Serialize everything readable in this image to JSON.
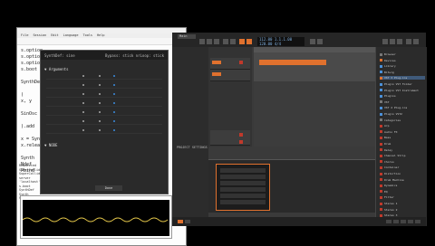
{
  "editor": {
    "menu": [
      "File",
      "Session",
      "Edit",
      "Language",
      "Tools",
      "Help"
    ],
    "code_lines": [
      "s.options",
      "s.options",
      "s.options",
      "s.boot",
      "",
      "SynthDef",
      "",
      "(",
      "  x, y",
      "",
      "  SinOsc",
      "",
      ").add",
      "",
      "x = Synth",
      "x.release",
      "",
      "Synth",
      "Ndef",
      "Pbind"
    ],
    "post_lines": [
      "Requested",
      "SuperCollider",
      "SuperCollider",
      "server 'localhost'",
      "s.boot",
      "SynthDef",
      "Synth",
      "Synth"
    ]
  },
  "panel": {
    "header_left": "SynthDef: sine",
    "header_right": "Bypass: stick  nrLoop: stick",
    "section1": "Arguments",
    "section2": "NODE",
    "button": "Done"
  },
  "daw": {
    "tab": "Main",
    "counter_line1": "112.00  1.1.1.00",
    "counter_line2": "120.00  4/4",
    "inspector_label": "PROJECT SETTINGS",
    "browser_items": [
      {
        "label": "Browser",
        "color": "#777777"
      },
      {
        "label": "Devices",
        "color": "#e0712e"
      },
      {
        "label": "Library",
        "color": "#4a90d9"
      },
      {
        "label": "Bitwig",
        "color": "#4a90d9"
      },
      {
        "label": "VST 3 Plug-ins",
        "color": "#e0712e"
      },
      {
        "label": "Plugin VST Folder",
        "color": "#4a90d9"
      },
      {
        "label": "Plugin VST Instrument",
        "color": "#4a90d9"
      },
      {
        "label": "Plugins",
        "color": "#4a90d9"
      },
      {
        "label": "VST",
        "color": "#777777"
      },
      {
        "label": "VST 2 Plug-ins",
        "color": "#4a90d9"
      },
      {
        "label": "Plugin VST2",
        "color": "#4a90d9"
      },
      {
        "label": "Categories",
        "color": "#777777"
      },
      {
        "label": "Arp",
        "color": "#c0392b"
      },
      {
        "label": "Audio FX",
        "color": "#c0392b"
      },
      {
        "label": "Bass",
        "color": "#c0392b"
      },
      {
        "label": "Drum",
        "color": "#c0392b"
      },
      {
        "label": "Delay",
        "color": "#c0392b"
      },
      {
        "label": "Channel Strip",
        "color": "#c0392b"
      },
      {
        "label": "Chorus",
        "color": "#c0392b"
      },
      {
        "label": "Container",
        "color": "#c0392b"
      },
      {
        "label": "Distortion",
        "color": "#c0392b"
      },
      {
        "label": "Drum Machine",
        "color": "#c0392b"
      },
      {
        "label": "Dynamics",
        "color": "#c0392b"
      },
      {
        "label": "EQ",
        "color": "#c0392b"
      },
      {
        "label": "Filter",
        "color": "#c0392b"
      },
      {
        "label": "Stereo 1",
        "color": "#c0392b"
      },
      {
        "label": "Stereo 2",
        "color": "#c0392b"
      },
      {
        "label": "Stereo 3",
        "color": "#c0392b"
      }
    ],
    "accent": "#e0712e"
  }
}
